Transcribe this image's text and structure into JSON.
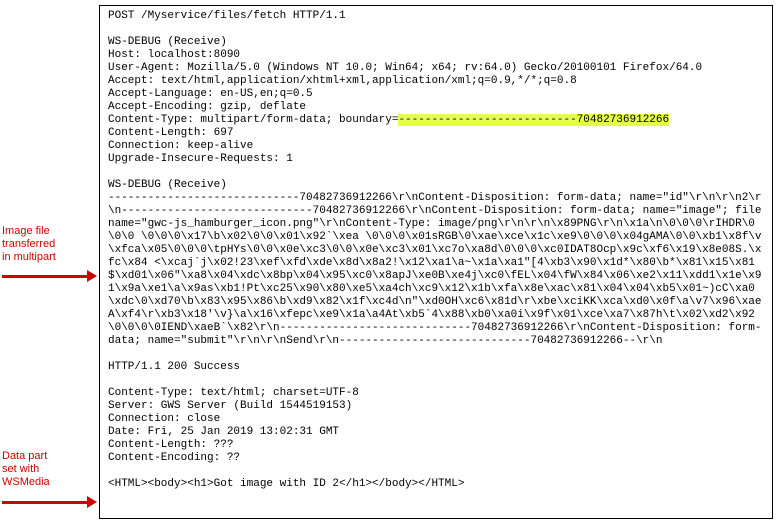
{
  "annotations": {
    "ann1_line1": "Image file",
    "ann1_line2": "transferred",
    "ann1_line3": "in multipart",
    "ann2_line1": "Data part",
    "ann2_line2": "set with",
    "ann2_line3": "WSMedia"
  },
  "request": {
    "line": "POST /Myservice/files/fetch HTTP/1.1",
    "debug_header": "WS-DEBUG (Receive)",
    "host": "Host: localhost:8090",
    "user_agent": "User-Agent: Mozilla/5.0 (Windows NT 10.0; Win64; x64; rv:64.0) Gecko/20100101 Firefox/64.0",
    "accept": "Accept: text/html,application/xhtml+xml,application/xml;q=0.9,*/*;q=0.8",
    "accept_lang": "Accept-Language: en-US,en;q=0.5",
    "accept_enc": "Accept-Encoding: gzip, deflate",
    "content_type_prefix": "Content-Type: multipart/form-data; boundary=",
    "boundary_highlight": "---------------------------70482736912266",
    "content_length": "Content-Length: 697",
    "connection": "Connection: keep-alive",
    "upgrade": "Upgrade-Insecure-Requests: 1"
  },
  "body": {
    "debug_header": "WS-DEBUG (Receive)",
    "raw": "-----------------------------70482736912266\\r\\nContent-Disposition: form-data; name=\"id\"\\r\\n\\r\\n2\\r\\n-----------------------------70482736912266\\r\\nContent-Disposition: form-data; name=\"image\"; filename=\"gwc-js_hamburger_icon.png\"\\r\\nContent-Type: image/png\\r\\n\\r\\n\\x89PNG\\r\\n\\x1a\\n\\0\\0\\0\\rIHDR\\0\\0\\0 \\0\\0\\0\\x17\\b\\x02\\0\\0\\x01\\x92`\\xea \\0\\0\\0\\x01sRGB\\0\\xae\\xce\\x1c\\xe9\\0\\0\\0\\x04gAMA\\0\\0\\xb1\\x8f\\v\\xfca\\x05\\0\\0\\0\\tpHYs\\0\\0\\x0e\\xc3\\0\\0\\x0e\\xc3\\x01\\xc7o\\xa8d\\0\\0\\0\\xc0IDAT8Ocp\\x9c\\xf6\\x19\\x8e08S.\\xfc\\x84 <\\xcaj`j\\x02!23\\xef\\xfd\\xde\\x8d\\x8a2!\\x12\\xa1\\a~\\x1a\\xa1\"[4\\xb3\\x90\\x1d*\\x80\\b*\\x81\\x15\\x81$\\xd01\\x06\"\\xa8\\x04\\xdc\\x8bp\\x04\\x95\\xc0\\x8apJ\\xe0B\\xe4j\\xc0\\fEL\\x04\\fW\\x84\\x06\\xe2\\x11\\xdd1\\x1e\\x91\\x9a\\xe1\\a\\x9as\\xb1!Pt\\xc25\\x90\\x80\\xe5\\xa4ch\\xc9\\x12\\x1b\\xfa\\x8e\\xac\\x81\\x04\\x04\\xb5\\x01~)cC\\xa0\\xdc\\0\\xd70\\b\\x83\\x95\\x86\\b\\xd9\\x82\\x1f\\xc4d\\n\"\\xd0OH\\xc6\\x81d\\r\\xbe\\xciKK\\xca\\xd0\\x0f\\a\\v7\\x96\\xaeA\\xf4\\r\\xb3\\x18'\\v}\\a\\x16\\xfepc\\xe9\\x1a\\a4At\\xb5`4\\x88\\xb0\\xa0i\\x9f\\x01\\xce\\xa7\\x87h\\t\\x02\\xd2\\x92\\0\\0\\0\\0IEND\\xaeB`\\x82\\r\\n-----------------------------70482736912266\\r\\nContent-Disposition: form-data; name=\"submit\"\\r\\n\\r\\nSend\\r\\n-----------------------------70482736912266--\\r\\n"
  },
  "response": {
    "status": "HTTP/1.1 200 Success",
    "content_type": "Content-Type: text/html; charset=UTF-8",
    "server": "Server: GWS Server (Build 1544519153)",
    "connection": "Connection: close",
    "date": "Date: Fri, 25 Jan 2019 13:02:31 GMT",
    "content_length": "Content-Length: ???",
    "content_encoding": "Content-Encoding: ??",
    "body": "<HTML><body><h1>Got image with ID 2</h1></body></HTML>"
  }
}
